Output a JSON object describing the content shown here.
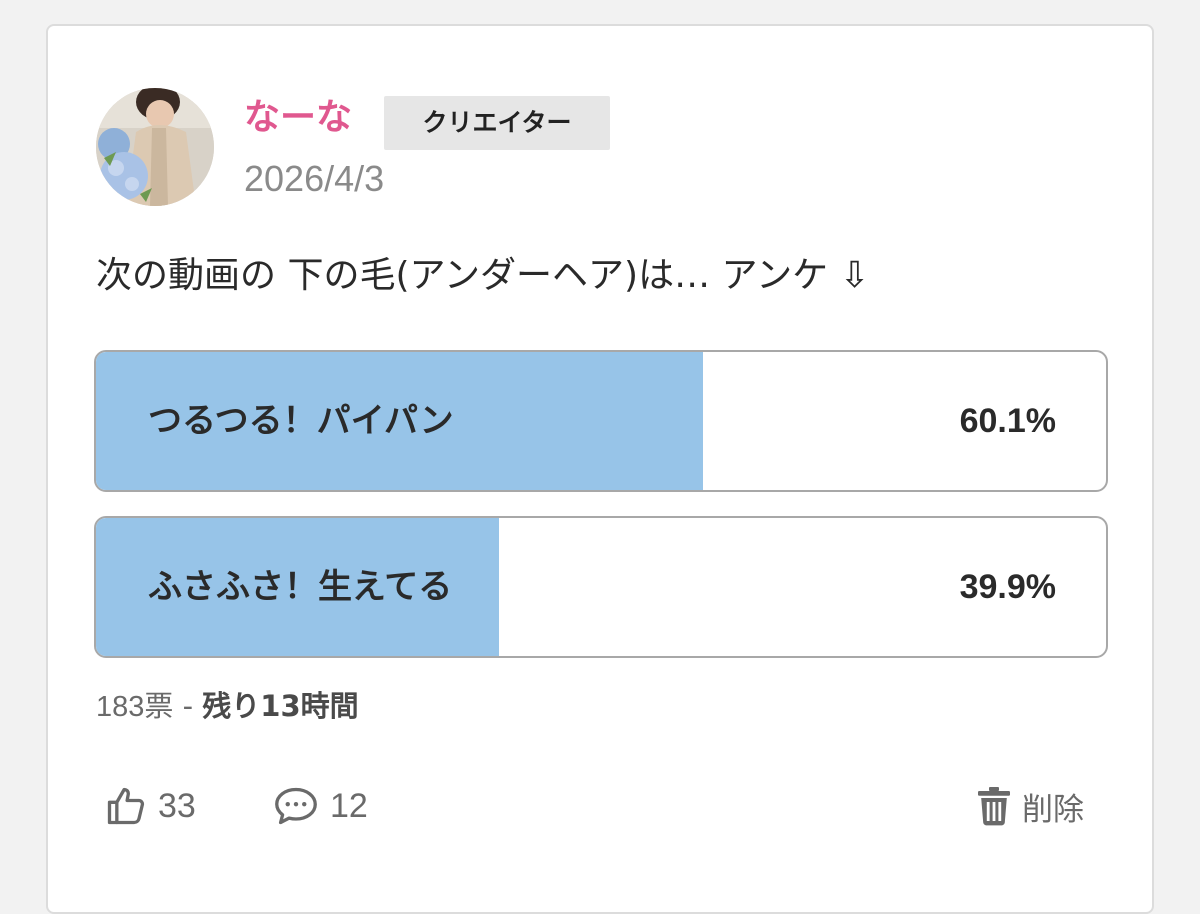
{
  "post": {
    "author": {
      "name": "なーな",
      "badge": "クリエイター"
    },
    "date": "2026/4/3",
    "text": "次の動画の 下の毛(アンダーヘア)は… アンケ ⇩"
  },
  "poll": {
    "options": [
      {
        "label": "つるつる！パイパン",
        "percent_text": "60.1%",
        "percent": 60.1
      },
      {
        "label": "ふさふさ！生えてる",
        "percent_text": "39.9%",
        "percent": 39.9
      }
    ],
    "votes": "183票",
    "separator": " - ",
    "remaining": "残り13時間"
  },
  "actions": {
    "like_count": "33",
    "comment_count": "12",
    "delete_label": "削除"
  },
  "colors": {
    "name": "#e0588f",
    "poll_fill": "#97c4e8",
    "badge_bg": "#e6e6e6"
  },
  "icons": {
    "like": "thumbs-up-icon",
    "comment": "speech-bubble-icon",
    "delete": "trash-icon"
  }
}
